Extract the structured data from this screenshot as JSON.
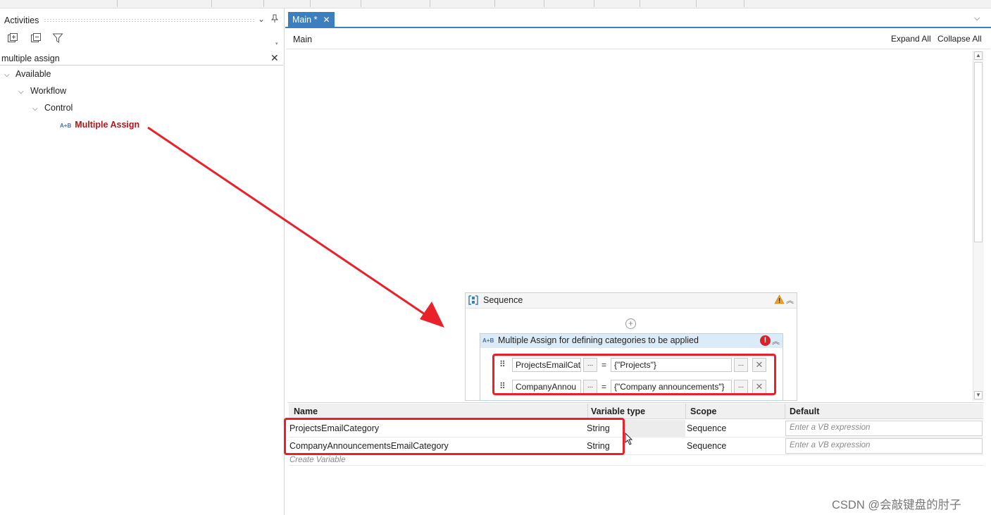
{
  "left_panel": {
    "title": "Activities",
    "search": {
      "value": "multiple assign",
      "placeholder": ""
    },
    "tree": {
      "available": "Available",
      "workflow": "Workflow",
      "control": "Control",
      "multiple_assign_icon": "A+B",
      "multiple_assign": "Multiple Assign"
    }
  },
  "tabs": [
    {
      "label": "Main *",
      "active": true
    }
  ],
  "designer": {
    "breadcrumb": "Main",
    "expand_all": "Expand All",
    "collapse_all": "Collapse All"
  },
  "sequence": {
    "title": "Sequence",
    "multiple_assign": {
      "icon": "A+B",
      "title": "Multiple Assign for defining categories to be applied",
      "rows": [
        {
          "to": "ProjectsEmailCat",
          "value": "{\"Projects\"}"
        },
        {
          "to": "CompanyAnnou",
          "value": "{\"Company announcements\"}"
        }
      ],
      "ellipsis": "...",
      "equals": "="
    }
  },
  "variables": {
    "columns": {
      "name": "Name",
      "type": "Variable type",
      "scope": "Scope",
      "default": "Default"
    },
    "rows": [
      {
        "name": "ProjectsEmailCategory",
        "type": "String",
        "scope": "Sequence",
        "default_placeholder": "Enter a VB expression"
      },
      {
        "name": "CompanyAnnouncementsEmailCategory",
        "type": "String",
        "scope": "Sequence",
        "default_placeholder": "Enter a VB expression"
      }
    ],
    "create_variable": "Create Variable"
  },
  "watermark": "CSDN @会敲键盘的肘子",
  "colors": {
    "accent": "#3c7fc1",
    "highlight_red": "#e8212a",
    "error": "#d8222a",
    "warning": "#f0a020"
  },
  "icons": [
    "pin-icon",
    "expand-tree-icon",
    "collapse-tree-icon",
    "filter-icon",
    "close-icon",
    "chevron-down-icon",
    "warning-icon",
    "error-icon",
    "sequence-icon",
    "add-activity-icon",
    "drag-grip-icon"
  ]
}
